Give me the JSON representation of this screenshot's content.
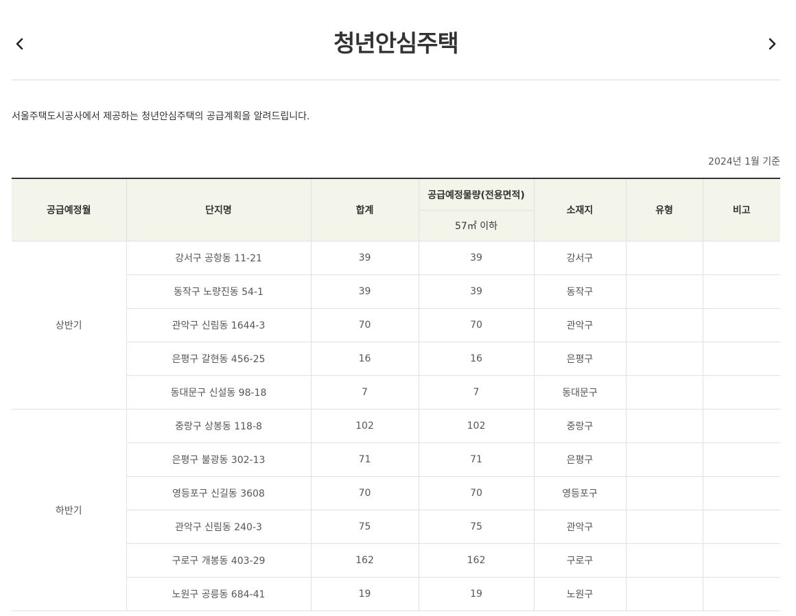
{
  "header": {
    "title": "청년안심주택",
    "prev_icon": "chevron-left-icon",
    "next_icon": "chevron-right-icon"
  },
  "description": "서울주택도시공사에서 제공하는 청년안심주택의 공급계획을 알려드립니다.",
  "basis_date": "2024년 1월 기준",
  "table": {
    "headers": {
      "month": "공급예정월",
      "complex": "단지명",
      "total": "합계",
      "supply": "공급예정물량(전용면적)",
      "supply_sub": "57㎡ 이하",
      "location": "소재지",
      "type": "유형",
      "note": "비고"
    },
    "groups": [
      {
        "period": "상반기",
        "rows": [
          {
            "complex": "강서구 공항동 11-21",
            "total": "39",
            "area": "39",
            "location": "강서구",
            "type": "",
            "note": ""
          },
          {
            "complex": "동작구 노량진동 54-1",
            "total": "39",
            "area": "39",
            "location": "동작구",
            "type": "",
            "note": ""
          },
          {
            "complex": "관악구 신림동 1644-3",
            "total": "70",
            "area": "70",
            "location": "관악구",
            "type": "",
            "note": ""
          },
          {
            "complex": "은평구 갈현동 456-25",
            "total": "16",
            "area": "16",
            "location": "은평구",
            "type": "",
            "note": ""
          },
          {
            "complex": "동대문구 신설동 98-18",
            "total": "7",
            "area": "7",
            "location": "동대문구",
            "type": "",
            "note": ""
          }
        ]
      },
      {
        "period": "하반기",
        "rows": [
          {
            "complex": "중랑구 상봉동 118-8",
            "total": "102",
            "area": "102",
            "location": "중랑구",
            "type": "",
            "note": ""
          },
          {
            "complex": "은평구 불광동 302-13",
            "total": "71",
            "area": "71",
            "location": "은평구",
            "type": "",
            "note": ""
          },
          {
            "complex": "영등포구 신길동 3608",
            "total": "70",
            "area": "70",
            "location": "영등포구",
            "type": "",
            "note": ""
          },
          {
            "complex": "관악구 신림동 240-3",
            "total": "75",
            "area": "75",
            "location": "관악구",
            "type": "",
            "note": ""
          },
          {
            "complex": "구로구 개봉동 403-29",
            "total": "162",
            "area": "162",
            "location": "구로구",
            "type": "",
            "note": ""
          },
          {
            "complex": "노원구 공릉동 684-41",
            "total": "19",
            "area": "19",
            "location": "노원구",
            "type": "",
            "note": ""
          }
        ]
      }
    ]
  }
}
